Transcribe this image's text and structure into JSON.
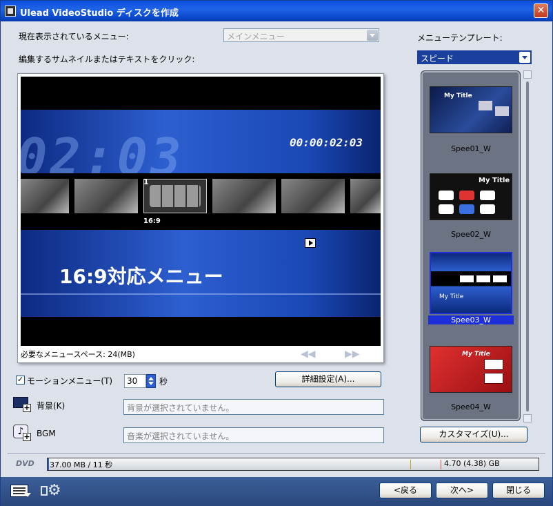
{
  "window": {
    "title": "Ulead VideoStudio ディスクを作成",
    "close_glyph": "✕"
  },
  "current_menu": {
    "label": "現在表示されているメニュー:",
    "value": "メインメニュー"
  },
  "instruction": "編集するサムネイルまたはテキストをクリック:",
  "preview": {
    "big_digits": "02:03",
    "timecode": "00:00:02:03",
    "thumb_number": "1",
    "thumb_caption": "16:9",
    "menu_title": "16:9対応メニュー",
    "space_text": "必要なメニュースペース: 24(MB)",
    "prev_glyph": "◀◀",
    "next_glyph": "▶▶"
  },
  "motion_menu": {
    "checked": true,
    "check_glyph": "✓",
    "label": "モーションメニュー(T)",
    "seconds_value": "30",
    "seconds_unit": "秒"
  },
  "advanced_button": "詳細設定(A)...",
  "background": {
    "label": "背景(K)",
    "placeholder": "背景が選択されていません。"
  },
  "bgm": {
    "label": "BGM",
    "placeholder": "音楽が選択されていません。"
  },
  "templates": {
    "label": "メニューテンプレート:",
    "category": "スピード",
    "items": [
      {
        "name": "Spee01_W",
        "thumb_text": "My Title"
      },
      {
        "name": "Spee02_W",
        "thumb_text": "My Title"
      },
      {
        "name": "Spee03_W",
        "thumb_text": "My Title",
        "selected": true
      },
      {
        "name": "Spee04_W",
        "thumb_text": "My Title"
      }
    ],
    "customize_button": "カスタマイズ(U)..."
  },
  "capacity": {
    "disc_type": "DVD",
    "used": "37.00 MB / 11 秒",
    "total": "4.70 (4.38) GB"
  },
  "footer": {
    "back": "<戻る",
    "next": "次へ>",
    "close": "閉じる"
  },
  "colors": {
    "accent_blue": "#2d5fd0",
    "selection": "#1c2fd8"
  }
}
